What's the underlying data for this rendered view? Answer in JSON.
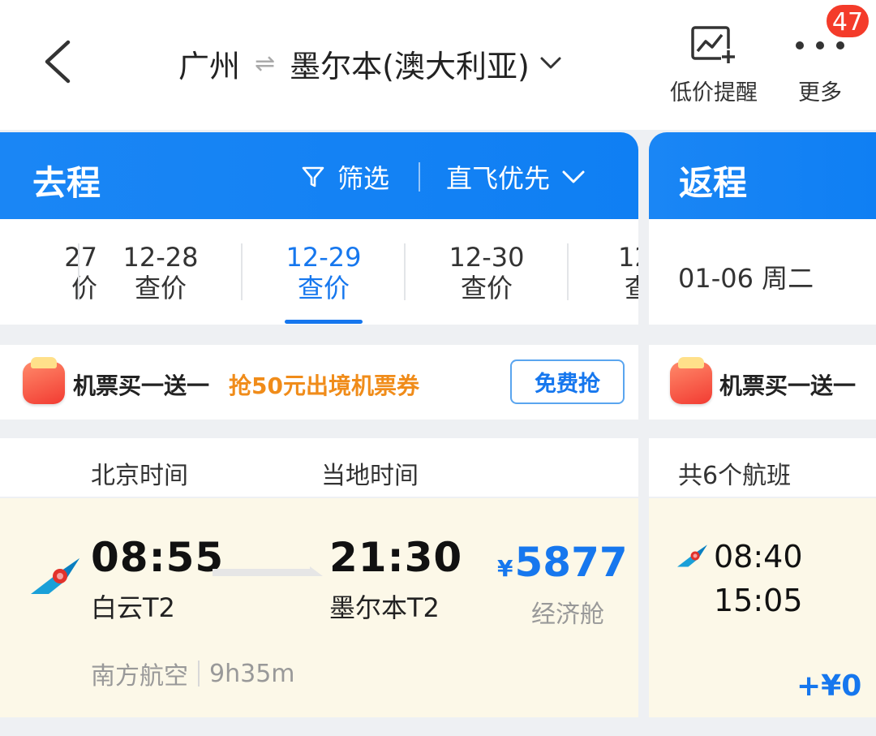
{
  "header": {
    "origin": "广州",
    "route_arrow": "⇌",
    "destination": "墨尔本(澳大利亚)",
    "actions": [
      {
        "label": "低价提醒",
        "icon": "chart-plus-icon"
      },
      {
        "label": "更多",
        "icon": "more-dots-icon"
      }
    ],
    "badge_count": "47"
  },
  "outbound": {
    "title": "去程",
    "filter_label": "筛选",
    "sort_label": "直飞优先",
    "dates": [
      {
        "date": "27",
        "sub": "价"
      },
      {
        "date": "12-28",
        "sub": "查价"
      },
      {
        "date": "12-29",
        "sub": "查价",
        "selected": true
      },
      {
        "date": "12-30",
        "sub": "查价"
      },
      {
        "date": "12",
        "sub": "查"
      }
    ],
    "promo": {
      "text": "机票买一送一",
      "coupon": "抢50元出境机票券",
      "button": "免费抢"
    },
    "time_headers": {
      "beijing": "北京时间",
      "local": "当地时间"
    },
    "flight": {
      "depart_time": "08:55",
      "depart_airport": "白云T2",
      "arrive_time": "21:30",
      "arrive_airport": "墨尔本T2",
      "currency": "¥",
      "price": "5877",
      "cabin": "经济舱",
      "airline": "南方航空",
      "duration": "9h35m"
    }
  },
  "return": {
    "title": "返程",
    "date": "01-06 周二",
    "promo_text": "机票买一送一",
    "count": "共6个航班",
    "flight": {
      "depart_time": "08:40",
      "arrive_time": "15:05",
      "extra_price": "+¥0"
    }
  },
  "colors": {
    "brand_blue": "#1677ee",
    "header_gradient": "#1a86f5",
    "coupon_orange": "#f08c1a",
    "card_bg": "#fcf8e8",
    "badge_red": "#f43b2a"
  }
}
